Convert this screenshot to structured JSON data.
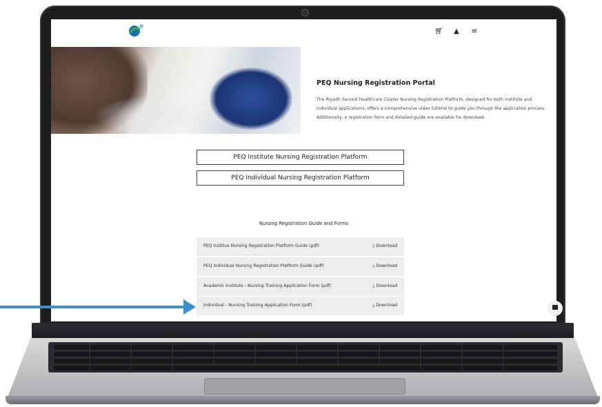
{
  "header": {
    "logo_icon": "peq-logo-icon",
    "cart_icon": "cart-icon",
    "user_icon": "user-icon",
    "menu_icon": "hamburger-menu-icon"
  },
  "hero": {
    "title": "PEQ Nursing Registration Portal",
    "description": "The Riyadh Second Healthcare Cluster Nursing Registration Platform, designed for both institute and individual applications, offers a comprehensive video tutorial to guide you through the application process. Additionally, a registration form and detailed guide are available for download."
  },
  "platform_buttons": [
    {
      "label": "PEQ Institute Nursing Registration Platform"
    },
    {
      "label": "PEQ Individual Nursing Registration Platform"
    }
  ],
  "guides": {
    "title": "Nursing Registration Guide and Forms",
    "items": [
      {
        "name": "PEQ Institue Nursing Registration Platform Guide (pdf)",
        "action": "Download"
      },
      {
        "name": "PEQ Individual Nursing Registration Platform Guide (pdf)",
        "action": "Download"
      },
      {
        "name": "Academic Institute - Nursing Training Application Form (pdf)",
        "action": "Download"
      },
      {
        "name": "Individual - Nursing Training Application Form (pdf)",
        "action": "Download"
      }
    ]
  },
  "colors": {
    "arrow": "#3a8fcd",
    "row_background": "#ededed"
  }
}
